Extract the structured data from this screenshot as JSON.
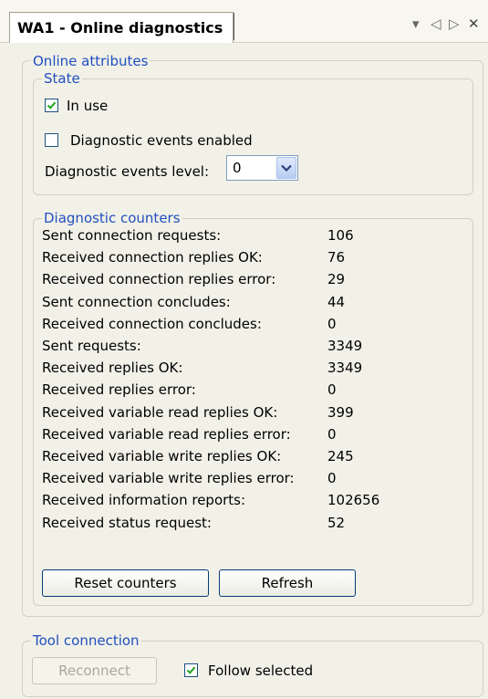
{
  "window": {
    "tab_title": "WA1 - Online diagnostics",
    "controls": {
      "dropdown": "▾",
      "prev": "◁",
      "next": "▷",
      "close": "✕"
    }
  },
  "online_attributes": {
    "legend": "Online attributes",
    "state": {
      "legend": "State",
      "in_use": {
        "label": "In use",
        "checked": true
      },
      "diag_events_enabled": {
        "label": "Diagnostic events enabled",
        "checked": false
      },
      "diag_events_level": {
        "label": "Diagnostic events level:",
        "value": "0"
      }
    },
    "counters": {
      "legend": "Diagnostic counters",
      "items": [
        {
          "label": "Sent connection requests:",
          "value": "106"
        },
        {
          "label": "Received connection replies OK:",
          "value": "76"
        },
        {
          "label": "Received connection replies error:",
          "value": "29"
        },
        {
          "label": "Sent connection concludes:",
          "value": "44"
        },
        {
          "label": "Received connection concludes:",
          "value": "0"
        },
        {
          "label": "Sent requests:",
          "value": "3349"
        },
        {
          "label": "Received replies OK:",
          "value": "3349"
        },
        {
          "label": "Received replies error:",
          "value": "0"
        },
        {
          "label": "Received variable read replies OK:",
          "value": "399"
        },
        {
          "label": "Received variable read replies error:",
          "value": "0"
        },
        {
          "label": "Received variable write replies OK:",
          "value": "245"
        },
        {
          "label": "Received variable write replies error:",
          "value": "0"
        },
        {
          "label": "Received information reports:",
          "value": "102656"
        },
        {
          "label": "Received status request:",
          "value": "52"
        }
      ],
      "reset_label": "Reset counters",
      "refresh_label": "Refresh"
    }
  },
  "tool_connection": {
    "legend": "Tool connection",
    "reconnect_label": "Reconnect",
    "follow_selected": {
      "label": "Follow selected",
      "checked": true
    }
  },
  "colors": {
    "legend": "#1f4fbf",
    "panel": "#f2f1e8",
    "check": "#21a121"
  }
}
